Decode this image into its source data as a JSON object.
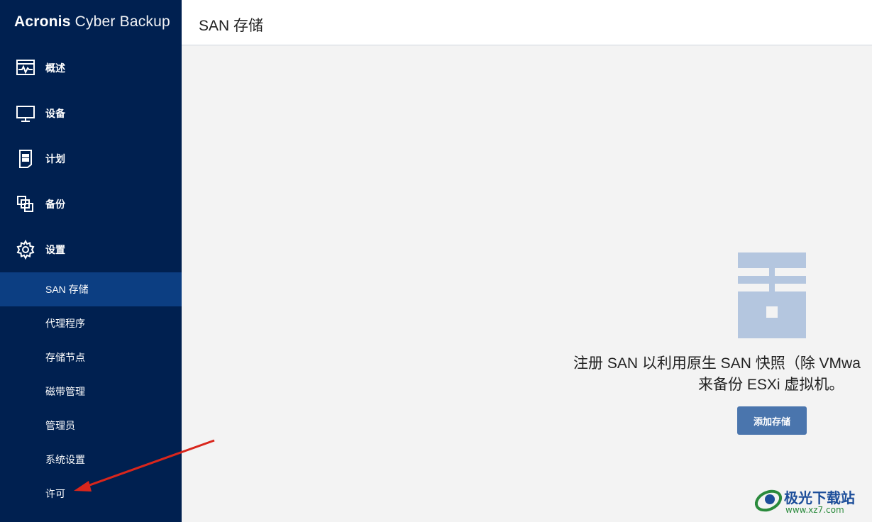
{
  "brand": {
    "part1": "Acronis",
    "part2": "Cyber Backup"
  },
  "nav": [
    {
      "label": "概述",
      "icon": "overview-monitor-icon"
    },
    {
      "label": "设备",
      "icon": "device-monitor-icon"
    },
    {
      "label": "计划",
      "icon": "plan-icon"
    },
    {
      "label": "备份",
      "icon": "backup-copy-icon"
    },
    {
      "label": "设置",
      "icon": "gear-icon"
    }
  ],
  "subnav": [
    {
      "label": "SAN 存储",
      "active": true
    },
    {
      "label": "代理程序"
    },
    {
      "label": "存储节点"
    },
    {
      "label": "磁带管理"
    },
    {
      "label": "管理员"
    },
    {
      "label": "系统设置"
    },
    {
      "label": "许可"
    }
  ],
  "header": {
    "title": "SAN 存储"
  },
  "main": {
    "message_line1": "注册 SAN 以利用原生 SAN 快照（除 VMwa",
    "message_line2": "来备份 ESXi 虚拟机。",
    "add_button": "添加存储",
    "graphic": "san-storage-icon"
  },
  "watermark": {
    "text": "极光下载站",
    "url": "www.xz7.com"
  },
  "colors": {
    "sidebar_bg": "#002050",
    "active_bg": "#0c3e82",
    "button_bg": "#4a75ad",
    "graphic": "#b4c6df",
    "annotation_arrow": "#d9261c"
  }
}
